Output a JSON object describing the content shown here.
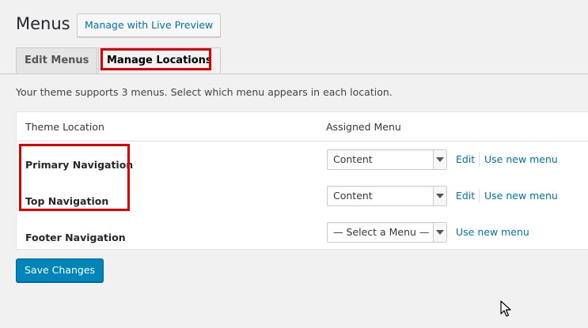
{
  "header": {
    "title": "Menus",
    "live_preview_label": "Manage with Live Preview"
  },
  "tabs": [
    {
      "label": "Edit Menus",
      "active": false
    },
    {
      "label": "Manage Locations",
      "active": true
    }
  ],
  "description": "Your theme supports 3 menus. Select which menu appears in each location.",
  "table": {
    "headers": {
      "location": "Theme Location",
      "menu": "Assigned Menu"
    },
    "rows": [
      {
        "location": "Primary Navigation",
        "selected": "Content",
        "edit_label": "Edit",
        "new_label": "Use new menu"
      },
      {
        "location": "Top Navigation",
        "selected": "Content",
        "edit_label": "Edit",
        "new_label": "Use new menu"
      },
      {
        "location": "Footer Navigation",
        "selected": "— Select a Menu —",
        "new_label": "Use new menu"
      }
    ]
  },
  "save_label": "Save Changes",
  "colors": {
    "link": "#0073aa",
    "primary_button": "#0085ba",
    "highlight": "#e00000"
  }
}
